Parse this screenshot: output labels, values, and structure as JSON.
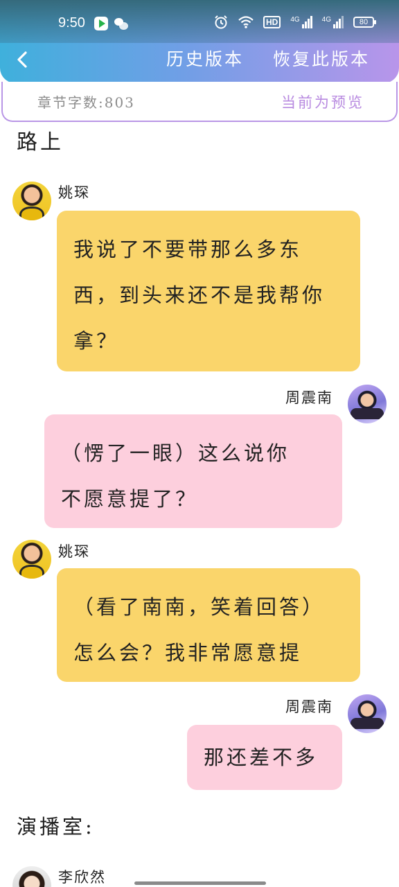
{
  "status_bar": {
    "time": "9:50",
    "network_4g_1": "4G",
    "network_4g_2": "4G",
    "hd": "HD",
    "battery": "80"
  },
  "header": {
    "history_label": "历史版本",
    "restore_label": "恢复此版本"
  },
  "info": {
    "word_count": "章节字数:803",
    "preview_label": "当前为预览"
  },
  "content": {
    "scene_1": "路上",
    "scene_2": "演播室:",
    "messages": [
      {
        "speaker": "姚琛",
        "line_1": "我说了不要带那么多东",
        "line_2": "西，到头来还不是我帮你",
        "line_3": "拿？"
      },
      {
        "speaker": "周震南",
        "line_1": "（愣了一眼）这么说你",
        "line_2": "不愿意提了？"
      },
      {
        "speaker": "姚琛",
        "line_1": "（看了南南，笑着回答）",
        "line_2": "怎么会？我非常愿意提"
      },
      {
        "speaker": "周震南",
        "line_1": "那还差不多"
      },
      {
        "speaker": "李欣然"
      }
    ]
  },
  "colors": {
    "header_start": "#3fb0dc",
    "header_end": "#b895ea",
    "bubble_yellow": "#fad56b",
    "bubble_pink": "#fdcfdd",
    "preview_text": "#b88ae0"
  }
}
